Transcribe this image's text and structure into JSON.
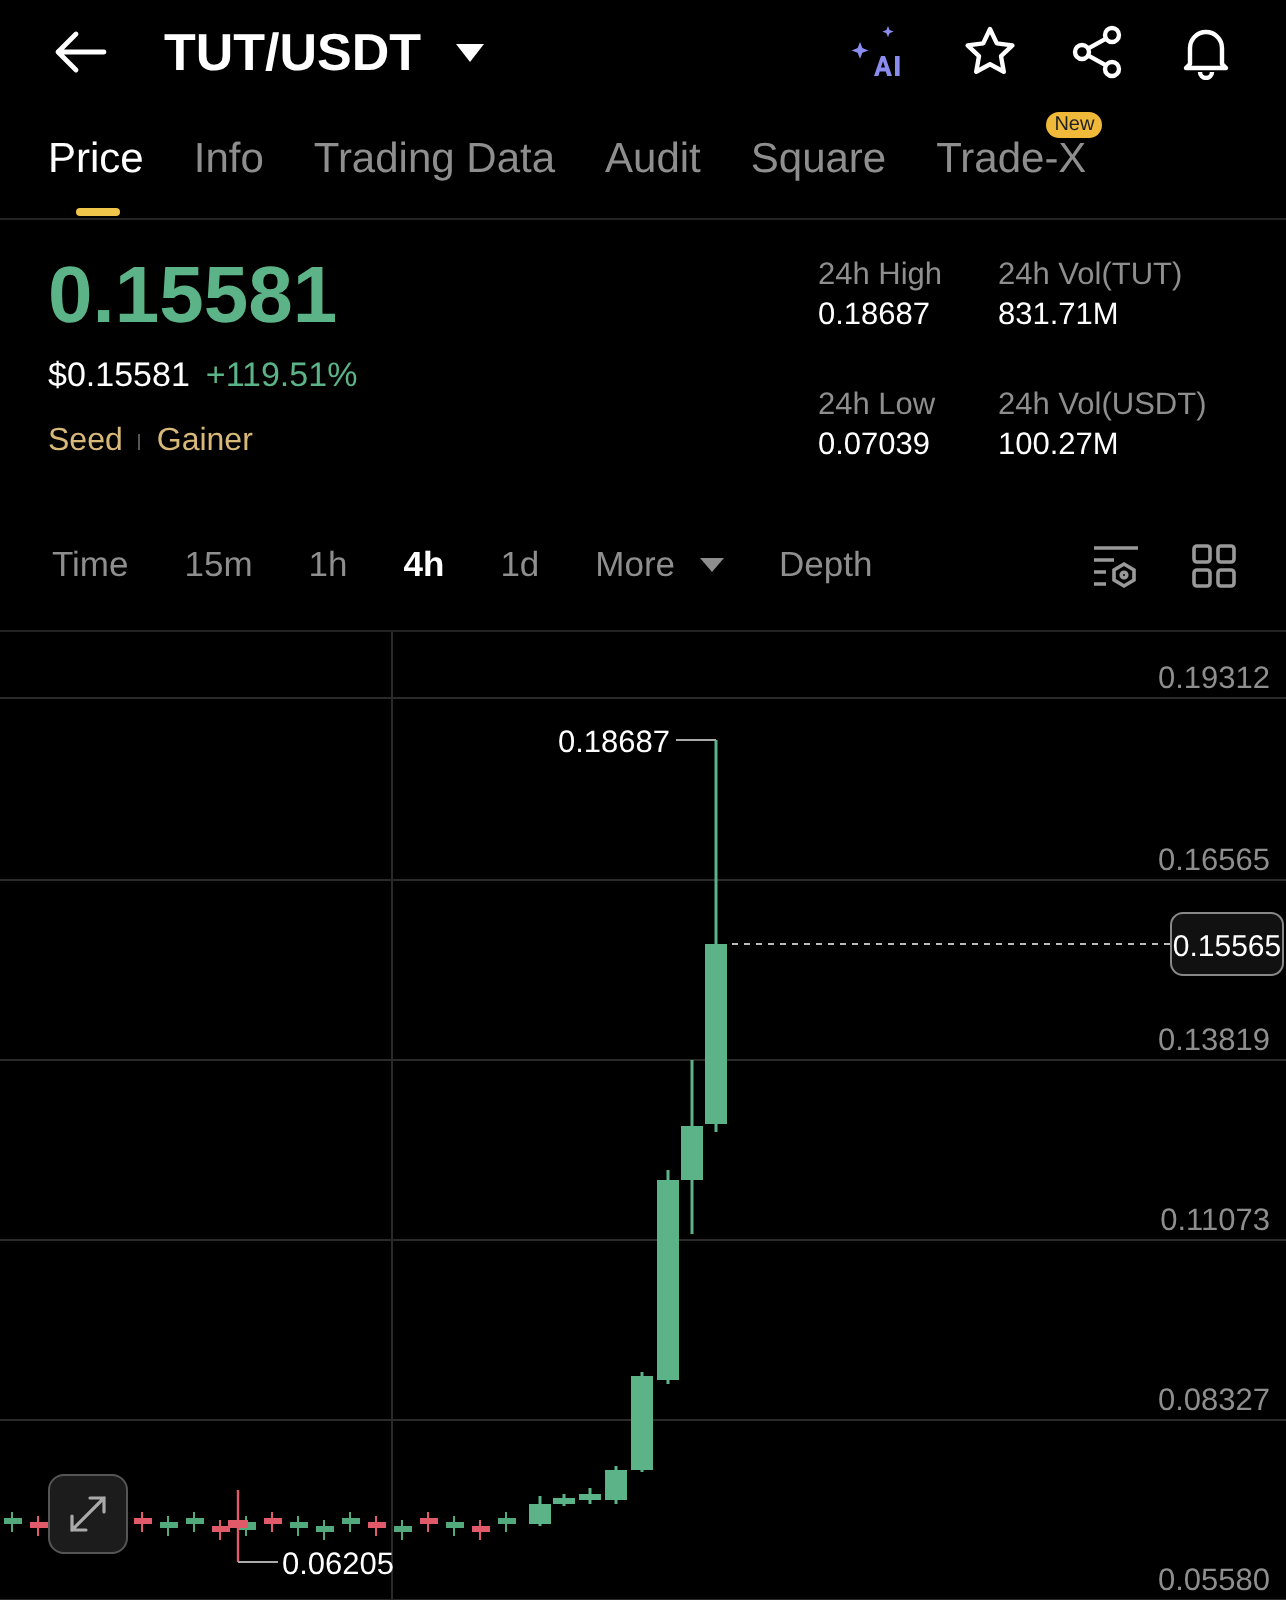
{
  "header": {
    "title": "TUT/USDT"
  },
  "tabs": [
    {
      "label": "Price",
      "selected": true
    },
    {
      "label": "Info",
      "selected": false
    },
    {
      "label": "Trading Data",
      "selected": false
    },
    {
      "label": "Audit",
      "selected": false
    },
    {
      "label": "Square",
      "selected": false
    },
    {
      "label": "Trade-X",
      "selected": false,
      "badge": "New"
    }
  ],
  "ticker": {
    "price": "0.15581",
    "usd_price": "$0.15581",
    "change": "+119.51%",
    "tags": [
      "Seed",
      "Gainer"
    ]
  },
  "stats": [
    {
      "label": "24h High",
      "value": "0.18687"
    },
    {
      "label": "24h Vol(TUT)",
      "value": "831.71M"
    },
    {
      "label": "24h Low",
      "value": "0.07039"
    },
    {
      "label": "24h Vol(USDT)",
      "value": "100.27M"
    }
  ],
  "intervals": [
    {
      "label": "Time",
      "selected": false
    },
    {
      "label": "15m",
      "selected": false
    },
    {
      "label": "1h",
      "selected": false
    },
    {
      "label": "4h",
      "selected": true
    },
    {
      "label": "1d",
      "selected": false
    },
    {
      "label": "More",
      "selected": false,
      "kind": "dropdown"
    },
    {
      "label": "Depth",
      "selected": false
    }
  ],
  "chart": {
    "y_axis_labels": [
      "0.19312",
      "0.16565",
      "0.13819",
      "0.11073",
      "0.08327",
      "0.05580"
    ],
    "high_marker": "0.18687",
    "low_marker": "0.06205",
    "current_price": "0.15565"
  }
}
